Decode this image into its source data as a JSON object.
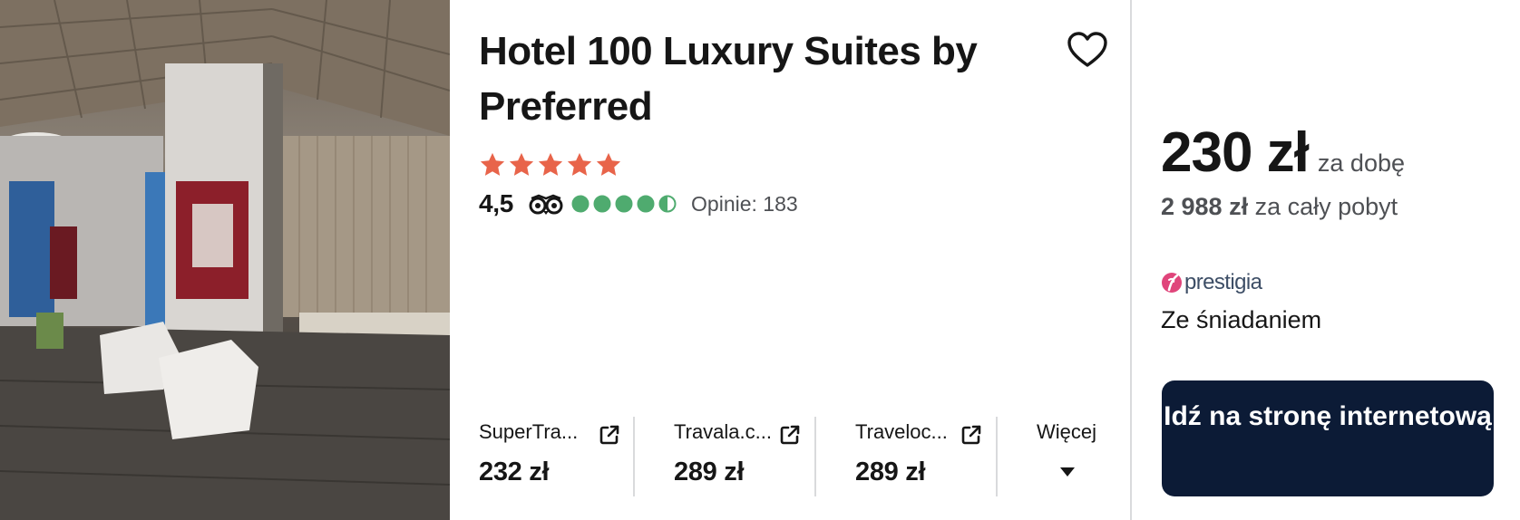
{
  "hotel": {
    "name": "Hotel 100 Luxury Suites by Preferred",
    "star_count": 5,
    "rating": "4,5",
    "rating_fraction": 0.9,
    "reviews_label": "Opinie: 183",
    "photo_subject": "hotel lobby interior"
  },
  "icons": {
    "favorite": "heart-outline-icon",
    "star": "star-icon",
    "review_site": "tripadvisor-owl-icon",
    "external": "external-link-icon",
    "expand": "caret-down-icon"
  },
  "offers": [
    {
      "provider": "SuperTra...",
      "price": "232 zł"
    },
    {
      "provider": "Travala.c...",
      "price": "289 zł"
    },
    {
      "provider": "Traveloc...",
      "price": "289 zł"
    }
  ],
  "more_label": "Więcej",
  "pricing": {
    "per_night": "230 zł",
    "per_night_suffix": "za dobę",
    "total": "2 988 zł",
    "total_suffix": "za cały pobyt",
    "provider_brand": "prestigia",
    "meal_plan": "Ze śniadaniem",
    "cta_label": "Idź na stronę internetową"
  },
  "colors": {
    "star": "#e8644a",
    "rating_bubble": "#4fab6f",
    "cta_bg": "#0c1b36",
    "brand_text": "#3d4e66",
    "brand_mark": "#e0457b",
    "muted_text": "#4e5054"
  }
}
